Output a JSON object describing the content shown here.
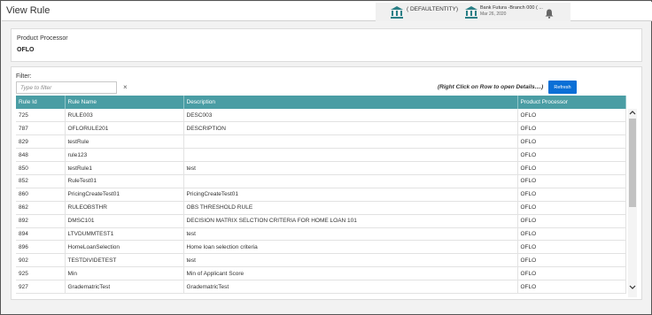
{
  "window": {
    "title": "View Rule"
  },
  "header": {
    "entity_label": "( DEFAULTENTITY)",
    "branch_name": "Bank Futura -Branch 000  ( ...",
    "branch_date": "Mar 26, 2020"
  },
  "product_card": {
    "label": "Product Processor",
    "value": "OFLO"
  },
  "filter": {
    "label": "Filter:",
    "placeholder": "Type to filter",
    "clear": "×",
    "hint": "(Right Click on Row to open Details....)",
    "refresh_label": "Refresh"
  },
  "table": {
    "columns": [
      "Rule Id",
      "Rule Name",
      "Description",
      "Product Processor"
    ],
    "rows": [
      [
        "725",
        "RULE003",
        "DESC003",
        "OFLO"
      ],
      [
        "787",
        "OFLORULE201",
        "DESCRIPTION",
        "OFLO"
      ],
      [
        "829",
        "testRule",
        "",
        "OFLO"
      ],
      [
        "848",
        "rule123",
        "",
        "OFLO"
      ],
      [
        "850",
        "testRule1",
        "test",
        "OFLO"
      ],
      [
        "852",
        "RuleTest01",
        "",
        "OFLO"
      ],
      [
        "860",
        "PricingCreateTest01",
        "PricingCreateTest01",
        "OFLO"
      ],
      [
        "862",
        "RULEOBSTHR",
        "OBS THRESHOLD RULE",
        "OFLO"
      ],
      [
        "892",
        "DMSC101",
        "DECISION MATRIX SELCTION CRITERIA FOR HOME LOAN 101",
        "OFLO"
      ],
      [
        "894",
        "LTVDUMMTEST1",
        "test",
        "OFLO"
      ],
      [
        "896",
        "HomeLoanSelection",
        "Home loan selection criteria",
        "OFLO"
      ],
      [
        "902",
        "TESTDIVIDETEST",
        "test",
        "OFLO"
      ],
      [
        "925",
        "Min",
        "Min of Applicant Score",
        "OFLO"
      ],
      [
        "927",
        "GradematricTest",
        "GradematricTest",
        "OFLO"
      ]
    ]
  },
  "icons": {
    "entity": "bank-building-icon",
    "branch": "bank-building-icon",
    "notifications": "bell-icon",
    "scroll_up": "chevron-up-icon",
    "scroll_down": "chevron-down-icon"
  },
  "colors": {
    "header_teal": "#4a9da4",
    "refresh_blue": "#0a6fd6",
    "icon_teal": "#2a7f86"
  }
}
